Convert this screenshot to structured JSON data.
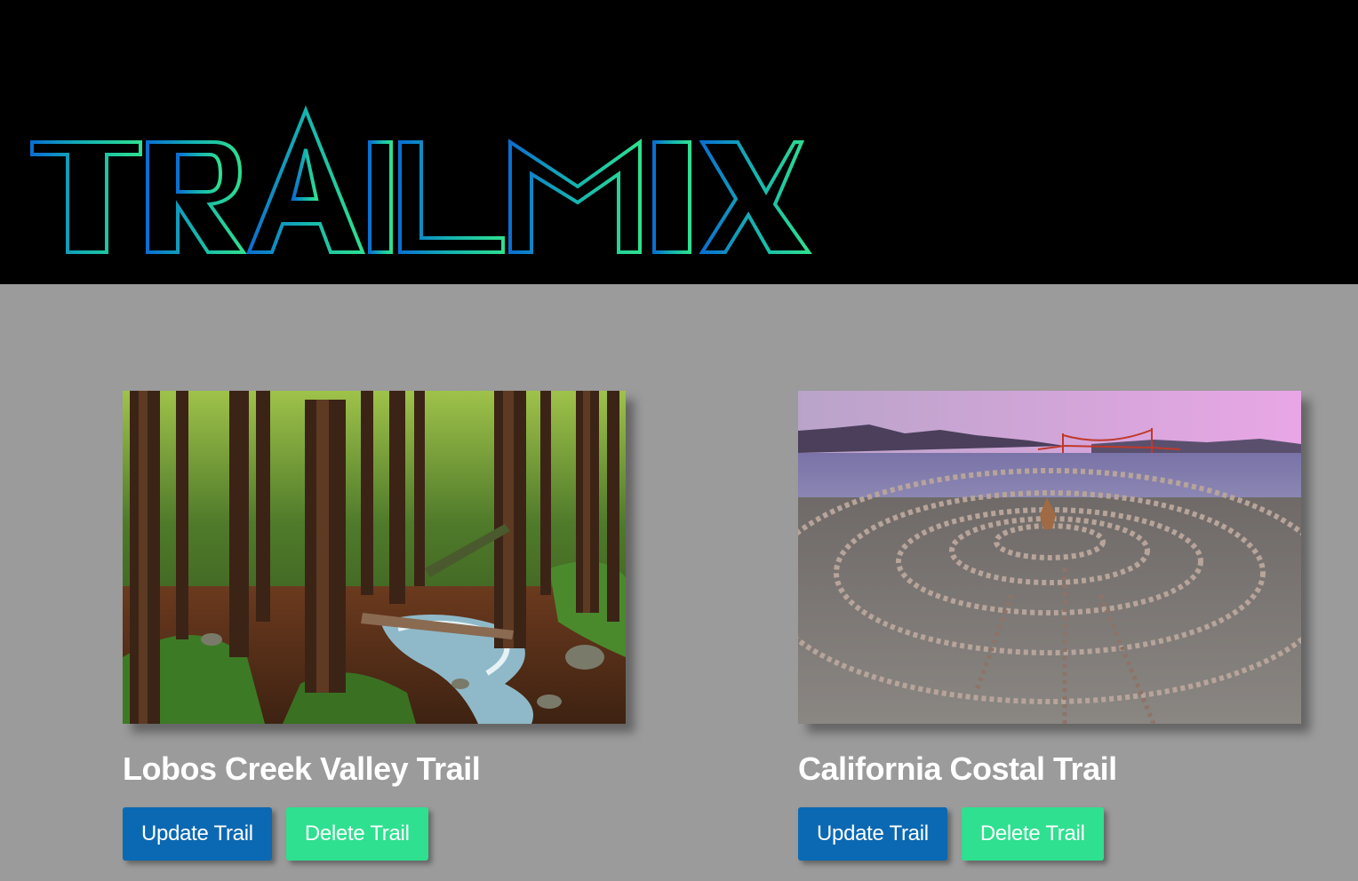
{
  "header": {
    "logo_text": "TRAILMIX",
    "logo_gradient": [
      "#0a6fd1",
      "#2ee08f"
    ]
  },
  "trails": [
    {
      "title": "Lobos Creek Valley Trail",
      "image_subject": "redwood forest with creek",
      "update_label": "Update Trail",
      "delete_label": "Delete Trail"
    },
    {
      "title": "California Costal Trail",
      "image_subject": "stone labyrinth by the bay with Golden Gate Bridge",
      "update_label": "Update Trail",
      "delete_label": "Delete Trail"
    }
  ],
  "colors": {
    "page_bg": "#9b9b9b",
    "header_bg": "#000000",
    "update_button": "#0b69b3",
    "delete_button": "#2ee08f"
  }
}
